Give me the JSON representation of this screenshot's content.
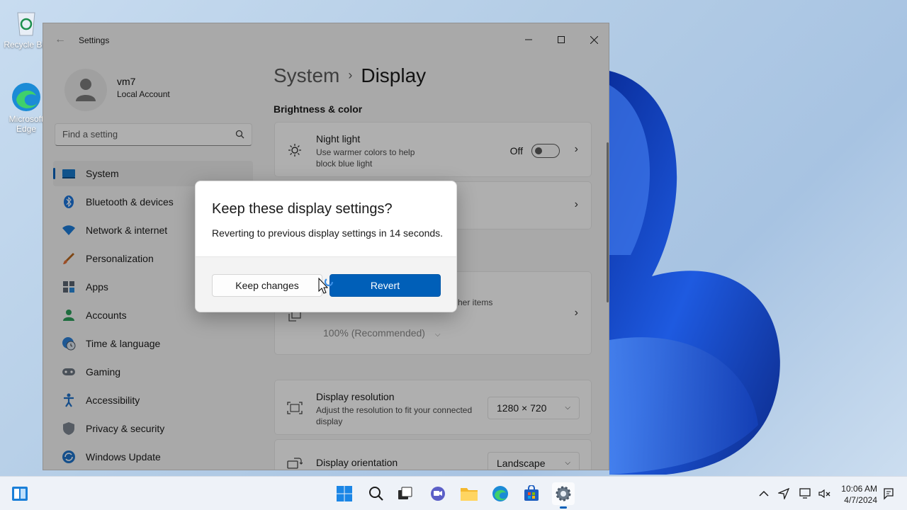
{
  "desktop": {
    "icons": [
      {
        "label": "Recycle Bin",
        "icon": "recycle-bin-icon"
      },
      {
        "label": "Microsoft Edge",
        "icon": "edge-icon"
      }
    ]
  },
  "window": {
    "app_title": "Settings",
    "controls": {
      "minimize": "minimize-icon",
      "maximize": "maximize-icon",
      "close": "close-icon"
    }
  },
  "profile": {
    "name": "vm7",
    "account_type": "Local Account"
  },
  "search": {
    "placeholder": "Find a setting"
  },
  "sidebar": {
    "items": [
      {
        "label": "System",
        "icon": "system-icon",
        "active": true
      },
      {
        "label": "Bluetooth & devices",
        "icon": "bluetooth-icon"
      },
      {
        "label": "Network & internet",
        "icon": "wifi-icon"
      },
      {
        "label": "Personalization",
        "icon": "brush-icon"
      },
      {
        "label": "Apps",
        "icon": "apps-icon"
      },
      {
        "label": "Accounts",
        "icon": "accounts-icon"
      },
      {
        "label": "Time & language",
        "icon": "globe-clock-icon"
      },
      {
        "label": "Gaming",
        "icon": "gamepad-icon"
      },
      {
        "label": "Accessibility",
        "icon": "accessibility-icon"
      },
      {
        "label": "Privacy & security",
        "icon": "shield-icon"
      },
      {
        "label": "Windows Update",
        "icon": "update-icon"
      }
    ]
  },
  "main": {
    "breadcrumb": {
      "parent": "System",
      "separator": "›",
      "current": "Display"
    },
    "section_brightness": "Brightness & color",
    "night_light": {
      "title": "Night light",
      "description": "Use warmer colors to help block blue light",
      "state_label": "Off",
      "enabled": false
    },
    "scale": {
      "desc_fragment": "her items",
      "value": "100% (Recommended)"
    },
    "resolution": {
      "title": "Display resolution",
      "description": "Adjust the resolution to fit your connected display",
      "value": "1280 × 720"
    },
    "orientation": {
      "title": "Display orientation",
      "value": "Landscape"
    }
  },
  "dialog": {
    "title": "Keep these display settings?",
    "message": "Reverting to previous display settings in 14 seconds.",
    "keep_label": "Keep changes",
    "revert_label": "Revert"
  },
  "taskbar": {
    "apps": [
      "widgets-icon",
      "start-icon",
      "search-icon",
      "task-view-icon",
      "chat-icon",
      "file-explorer-icon",
      "edge-icon",
      "store-icon",
      "settings-icon"
    ],
    "clock": {
      "time": "10:06 AM",
      "date": "4/7/2024"
    }
  },
  "colors": {
    "accent": "#005fb8"
  }
}
